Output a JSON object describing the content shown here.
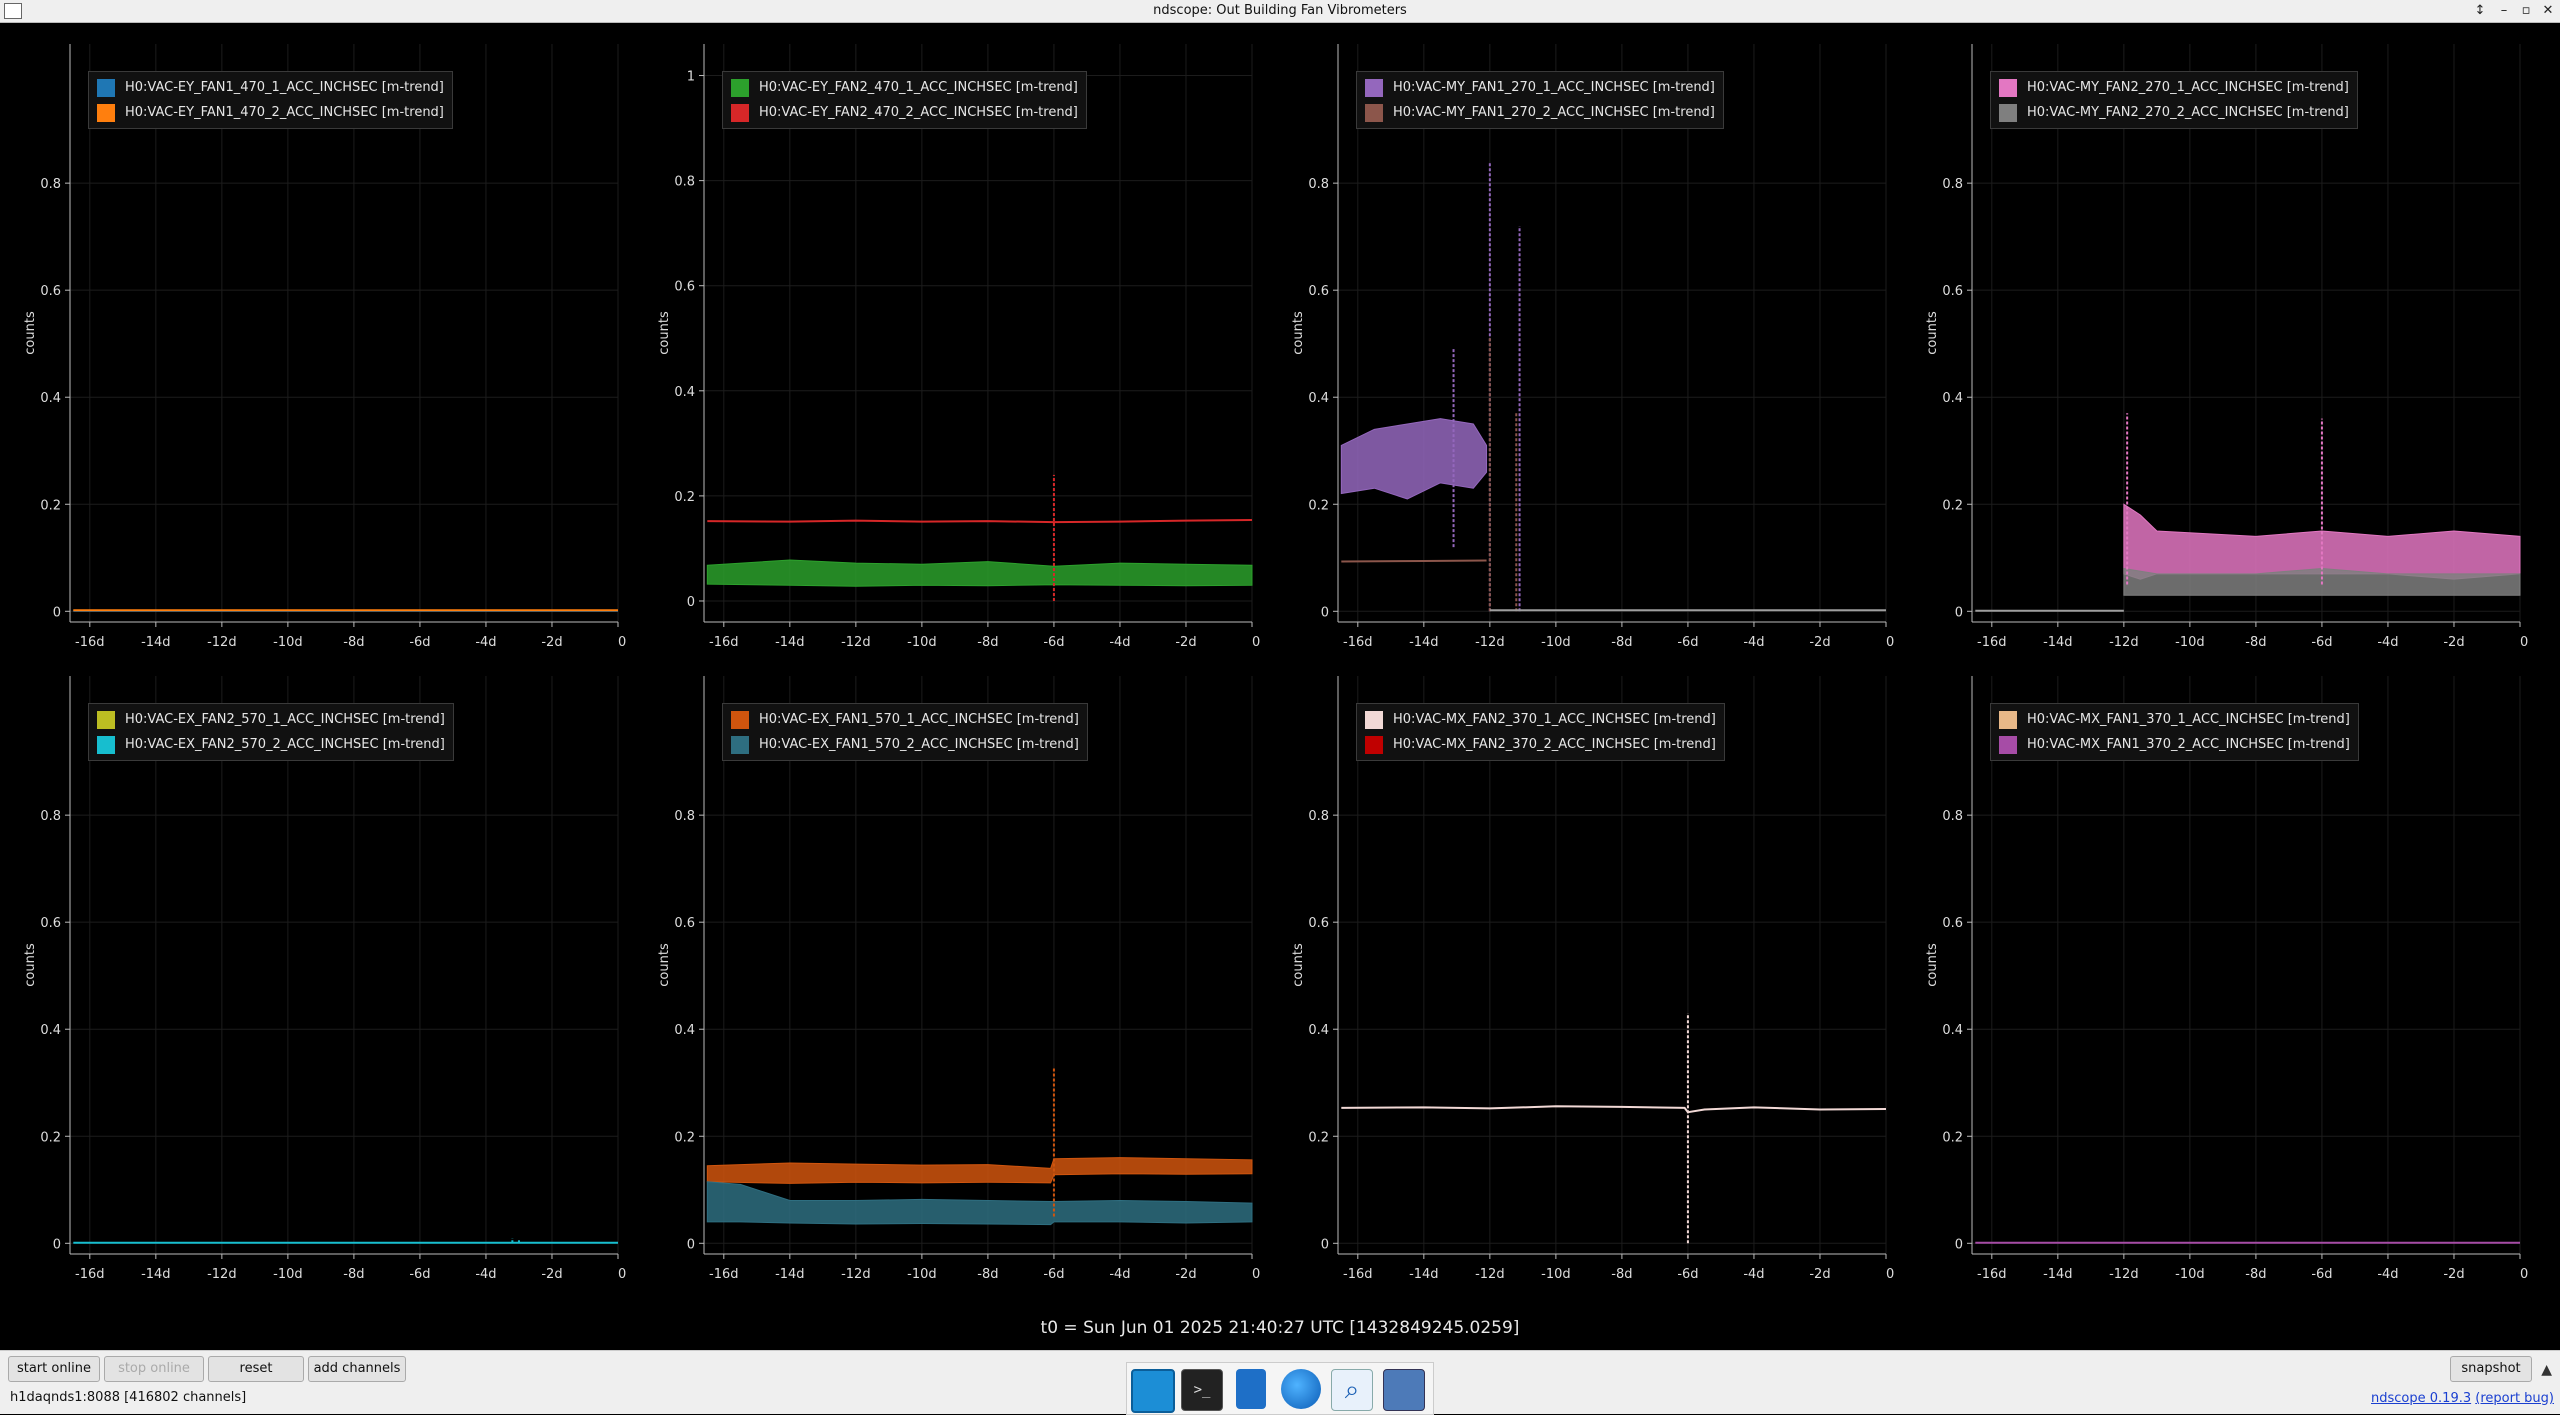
{
  "window": {
    "title": "ndscope: Out Building Fan Vibrometers",
    "controls": [
      "↕",
      "–",
      "▫",
      "✕"
    ]
  },
  "plots": [
    {
      "channels": [
        {
          "name": "H0:VAC-EY_FAN1_470_1_ACC_INCHSEC [m-trend]",
          "color": "#1f77b4"
        },
        {
          "name": "H0:VAC-EY_FAN1_470_2_ACC_INCHSEC [m-trend]",
          "color": "#ff7f0e"
        }
      ],
      "ylabel": "counts",
      "yticks": [
        0,
        0.2,
        0.4,
        0.6,
        0.8
      ],
      "ylim": [
        -0.02,
        1.06
      ],
      "series": [
        {
          "color": "#1f77b4",
          "kind": "line",
          "x": [
            -16.5,
            0
          ],
          "y": [
            0.001,
            0.001
          ]
        },
        {
          "color": "#ff7f0e",
          "kind": "line",
          "x": [
            -16.5,
            0
          ],
          "y": [
            0.002,
            0.002
          ]
        }
      ]
    },
    {
      "channels": [
        {
          "name": "H0:VAC-EY_FAN2_470_1_ACC_INCHSEC [m-trend]",
          "color": "#2ca02c"
        },
        {
          "name": "H0:VAC-EY_FAN2_470_2_ACC_INCHSEC [m-trend]",
          "color": "#d62728"
        }
      ],
      "ylabel": "counts",
      "yticks": [
        0,
        0.2,
        0.4,
        0.6,
        0.8,
        1
      ],
      "ylim": [
        -0.04,
        1.06
      ],
      "series": [
        {
          "color": "#d62728",
          "kind": "line",
          "x": [
            -16.5,
            -14,
            -12,
            -10,
            -8,
            -6,
            -4,
            -2,
            0
          ],
          "y": [
            0.152,
            0.151,
            0.153,
            0.151,
            0.152,
            0.15,
            0.151,
            0.153,
            0.154
          ]
        },
        {
          "color": "#2ca02c",
          "kind": "band",
          "x": [
            -16.5,
            -14,
            -12,
            -10,
            -8,
            -6,
            -4,
            -2,
            0
          ],
          "ylo": [
            0.032,
            0.03,
            0.028,
            0.03,
            0.029,
            0.031,
            0.03,
            0.029,
            0.03
          ],
          "yhi": [
            0.068,
            0.078,
            0.072,
            0.07,
            0.075,
            0.066,
            0.072,
            0.07,
            0.068
          ]
        },
        {
          "color": "#d62728",
          "kind": "spike",
          "x": [
            -6
          ],
          "y0": [
            0.0
          ],
          "y1": [
            0.24
          ]
        }
      ]
    },
    {
      "channels": [
        {
          "name": "H0:VAC-MY_FAN1_270_1_ACC_INCHSEC [m-trend]",
          "color": "#9467bd"
        },
        {
          "name": "H0:VAC-MY_FAN1_270_2_ACC_INCHSEC [m-trend]",
          "color": "#8c564b"
        }
      ],
      "ylabel": "counts",
      "yticks": [
        0,
        0.2,
        0.4,
        0.6,
        0.8
      ],
      "ylim": [
        -0.02,
        1.06
      ],
      "series": [
        {
          "color": "#9467bd",
          "kind": "band",
          "x": [
            -16.5,
            -15.5,
            -14.5,
            -13.5,
            -12.5,
            -12.1
          ],
          "ylo": [
            0.22,
            0.23,
            0.21,
            0.24,
            0.23,
            0.26
          ],
          "yhi": [
            0.31,
            0.34,
            0.35,
            0.36,
            0.35,
            0.31
          ]
        },
        {
          "color": "#8c564b",
          "kind": "line",
          "x": [
            -16.5,
            -14,
            -12.1
          ],
          "y": [
            0.093,
            0.094,
            0.095
          ]
        },
        {
          "color": "#9467bd",
          "kind": "spike",
          "x": [
            -13.1,
            -12.0,
            -11.1
          ],
          "y0": [
            0.12,
            0.0,
            0.0
          ],
          "y1": [
            0.49,
            0.84,
            0.72
          ]
        },
        {
          "color": "#8c564b",
          "kind": "spike",
          "x": [
            -12.0,
            -11.2
          ],
          "y0": [
            0.0,
            0.0
          ],
          "y1": [
            0.51,
            0.37
          ]
        },
        {
          "color": "#9e9e9e",
          "kind": "line",
          "x": [
            -12.0,
            0
          ],
          "y": [
            0.002,
            0.002
          ]
        }
      ]
    },
    {
      "channels": [
        {
          "name": "H0:VAC-MY_FAN2_270_1_ACC_INCHSEC [m-trend]",
          "color": "#e377c2"
        },
        {
          "name": "H0:VAC-MY_FAN2_270_2_ACC_INCHSEC [m-trend]",
          "color": "#7f7f7f"
        }
      ],
      "ylabel": "counts",
      "yticks": [
        0,
        0.2,
        0.4,
        0.6,
        0.8
      ],
      "ylim": [
        -0.02,
        1.06
      ],
      "series": [
        {
          "color": "#9e9e9e",
          "kind": "line",
          "x": [
            -16.5,
            -12.0
          ],
          "y": [
            0.001,
            0.001
          ]
        },
        {
          "color": "#e377c2",
          "kind": "band",
          "x": [
            -12.0,
            -11.5,
            -11.0,
            -8,
            -6,
            -4,
            -2,
            0
          ],
          "ylo": [
            0.07,
            0.06,
            0.07,
            0.07,
            0.07,
            0.07,
            0.06,
            0.07
          ],
          "yhi": [
            0.2,
            0.18,
            0.15,
            0.14,
            0.15,
            0.14,
            0.15,
            0.14
          ]
        },
        {
          "color": "#7f7f7f",
          "kind": "band",
          "x": [
            -12.0,
            -11.0,
            -8,
            -6,
            -4,
            -2,
            0
          ],
          "ylo": [
            0.03,
            0.03,
            0.03,
            0.03,
            0.03,
            0.03,
            0.03
          ],
          "yhi": [
            0.08,
            0.07,
            0.07,
            0.08,
            0.07,
            0.07,
            0.07
          ]
        },
        {
          "color": "#e377c2",
          "kind": "spike",
          "x": [
            -11.9,
            -6.0
          ],
          "y0": [
            0.05,
            0.05
          ],
          "y1": [
            0.37,
            0.36
          ]
        }
      ]
    },
    {
      "channels": [
        {
          "name": "H0:VAC-EX_FAN2_570_1_ACC_INCHSEC [m-trend]",
          "color": "#bcbd22"
        },
        {
          "name": "H0:VAC-EX_FAN2_570_2_ACC_INCHSEC [m-trend]",
          "color": "#17becf"
        }
      ],
      "ylabel": "counts",
      "yticks": [
        0,
        0.2,
        0.4,
        0.6,
        0.8
      ],
      "ylim": [
        -0.02,
        1.06
      ],
      "series": [
        {
          "color": "#17becf",
          "kind": "line",
          "x": [
            -16.5,
            0
          ],
          "y": [
            0.001,
            0.001
          ]
        },
        {
          "color": "#17becf",
          "kind": "spike",
          "x": [
            -3.2,
            -3.0
          ],
          "y0": [
            0.0,
            0.0
          ],
          "y1": [
            0.01,
            0.008
          ]
        }
      ]
    },
    {
      "channels": [
        {
          "name": "H0:VAC-EX_FAN1_570_1_ACC_INCHSEC [m-trend]",
          "color": "#d0550e"
        },
        {
          "name": "H0:VAC-EX_FAN1_570_2_ACC_INCHSEC [m-trend]",
          "color": "#2e6e80"
        }
      ],
      "ylabel": "counts",
      "yticks": [
        0,
        0.2,
        0.4,
        0.6,
        0.8
      ],
      "ylim": [
        -0.02,
        1.06
      ],
      "series": [
        {
          "color": "#d0550e",
          "kind": "band",
          "x": [
            -16.5,
            -14,
            -12,
            -10,
            -8,
            -6.1,
            -6.0,
            -4,
            -2,
            0
          ],
          "ylo": [
            0.115,
            0.112,
            0.114,
            0.113,
            0.114,
            0.113,
            0.128,
            0.13,
            0.129,
            0.13
          ],
          "yhi": [
            0.145,
            0.15,
            0.148,
            0.146,
            0.147,
            0.14,
            0.158,
            0.16,
            0.158,
            0.156
          ]
        },
        {
          "color": "#2e6e80",
          "kind": "band",
          "x": [
            -16.5,
            -15.5,
            -14,
            -12,
            -10,
            -8,
            -6.1,
            -6.0,
            -4,
            -2,
            0
          ],
          "ylo": [
            0.04,
            0.04,
            0.038,
            0.036,
            0.037,
            0.036,
            0.035,
            0.04,
            0.04,
            0.038,
            0.04
          ],
          "yhi": [
            0.115,
            0.11,
            0.08,
            0.08,
            0.082,
            0.08,
            0.078,
            0.078,
            0.08,
            0.078,
            0.075
          ]
        },
        {
          "color": "#d0550e",
          "kind": "spike",
          "x": [
            -6.0
          ],
          "y0": [
            0.05
          ],
          "y1": [
            0.33
          ]
        }
      ]
    },
    {
      "channels": [
        {
          "name": "H0:VAC-MX_FAN2_370_1_ACC_INCHSEC [m-trend]",
          "color": "#f2d9d6"
        },
        {
          "name": "H0:VAC-MX_FAN2_370_2_ACC_INCHSEC [m-trend]",
          "color": "#c00000"
        }
      ],
      "ylabel": "counts",
      "yticks": [
        0,
        0.2,
        0.4,
        0.6,
        0.8
      ],
      "ylim": [
        -0.02,
        1.06
      ],
      "series": [
        {
          "color": "#f2d9d6",
          "kind": "line",
          "x": [
            -16.5,
            -14,
            -12,
            -10,
            -8,
            -6.1,
            -6.0,
            -5.5,
            -4,
            -2,
            0
          ],
          "y": [
            0.253,
            0.254,
            0.252,
            0.256,
            0.255,
            0.253,
            0.245,
            0.25,
            0.254,
            0.25,
            0.251
          ]
        },
        {
          "color": "#f2d9d6",
          "kind": "spike",
          "x": [
            -6.0
          ],
          "y0": [
            0.0
          ],
          "y1": [
            0.43
          ]
        }
      ]
    },
    {
      "channels": [
        {
          "name": "H0:VAC-MX_FAN1_370_1_ACC_INCHSEC [m-trend]",
          "color": "#e8b888"
        },
        {
          "name": "H0:VAC-MX_FAN1_370_2_ACC_INCHSEC [m-trend]",
          "color": "#a64ca6"
        }
      ],
      "ylabel": "counts",
      "yticks": [
        0,
        0.2,
        0.4,
        0.6,
        0.8
      ],
      "ylim": [
        -0.02,
        1.06
      ],
      "series": [
        {
          "color": "#a64ca6",
          "kind": "line",
          "x": [
            -16.5,
            0
          ],
          "y": [
            0.001,
            0.001
          ]
        }
      ]
    }
  ],
  "xaxis": {
    "xlim": [
      -16.6,
      0
    ],
    "ticks": [
      -16,
      -14,
      -12,
      -10,
      -8,
      -6,
      -4,
      -2,
      0
    ],
    "tick_labels": [
      "-16d",
      "-14d",
      "-12d",
      "-10d",
      "-8d",
      "-6d",
      "-4d",
      "-2d",
      "0"
    ]
  },
  "t0_label": "t0 = Sun Jun 01 2025 21:40:27 UTC [1432849245.0259]",
  "buttons": {
    "start_online": "start online",
    "stop_online": "stop online",
    "reset": "reset",
    "add_channels": "add channels",
    "snapshot": "snapshot"
  },
  "status": "h1daqnds1:8088  [416802 channels]",
  "version": {
    "name": "ndscope 0.19.3",
    "report": "(report bug)"
  },
  "taskbar_icons": [
    "desktop-icon",
    "terminal-icon",
    "text-editor-icon",
    "browser-icon",
    "search-icon",
    "folder-icon"
  ]
}
